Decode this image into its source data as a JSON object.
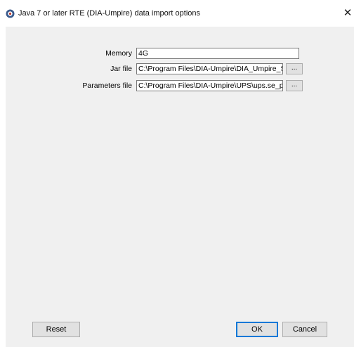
{
  "window": {
    "title": "Java 7 or later RTE (DIA-Umpire) data import options",
    "close_glyph": "✕",
    "icon": "app-icon"
  },
  "form": {
    "memory": {
      "label": "Memory",
      "value": "4G"
    },
    "jar_file": {
      "label": "Jar file",
      "value": "C:\\Program Files\\DIA-Umpire\\DIA_Umpire_SE",
      "browse_label": "..."
    },
    "parameters_file": {
      "label": "Parameters file",
      "value": "C:\\Program Files\\DIA-Umpire\\UPS\\ups.se_params",
      "browse_label": "..."
    }
  },
  "buttons": {
    "reset": "Reset",
    "ok": "OK",
    "cancel": "Cancel"
  },
  "colors": {
    "client_bg": "#f0f0f0",
    "button_bg": "#e1e1e1",
    "default_button_border": "#0078d7"
  }
}
